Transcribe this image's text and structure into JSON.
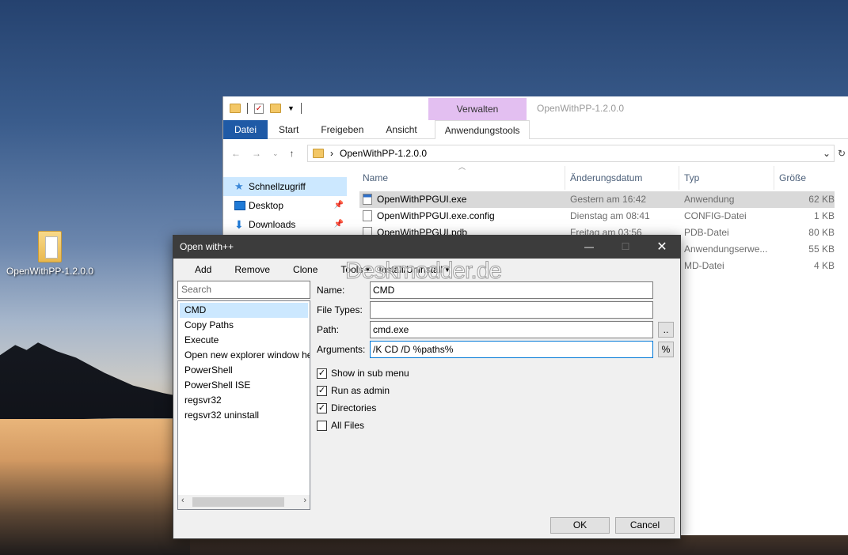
{
  "desktop": {
    "icon_label": "OpenWithPP-1.2.0.0"
  },
  "explorer": {
    "title": "OpenWithPP-1.2.0.0",
    "context_tab": "Verwalten",
    "ribbon_tabs": [
      "Datei",
      "Start",
      "Freigeben",
      "Ansicht",
      "Anwendungstools"
    ],
    "path": "OpenWithPP-1.2.0.0",
    "nav": {
      "quick_access": "Schnellzugriff",
      "desktop": "Desktop",
      "downloads": "Downloads"
    },
    "columns": {
      "name": "Name",
      "date": "Änderungsdatum",
      "type": "Typ",
      "size": "Größe"
    },
    "files": [
      {
        "name": "OpenWithPPGUI.exe",
        "date": "Gestern am 16:42",
        "type": "Anwendung",
        "size": "62 KB"
      },
      {
        "name": "OpenWithPPGUI.exe.config",
        "date": "Dienstag am 08:41",
        "type": "CONFIG-Datei",
        "size": "1 KB"
      },
      {
        "name": "OpenWithPPGUI.pdb",
        "date": "Freitag am 03:56",
        "type": "PDB-Datei",
        "size": "80 KB"
      },
      {
        "name": "",
        "date": "",
        "type": "Anwendungserwe...",
        "size": "55 KB"
      },
      {
        "name": "",
        "date": "",
        "type": "MD-Datei",
        "size": "4 KB"
      }
    ]
  },
  "dialog": {
    "title": "Open with++",
    "toolbar": {
      "add": "Add",
      "remove": "Remove",
      "clone": "Clone",
      "tools": "Tools",
      "install": "Install/Uninstall"
    },
    "search_placeholder": "Search",
    "items": [
      "CMD",
      "Copy Paths",
      "Execute",
      "Open new explorer window he",
      "PowerShell",
      "PowerShell ISE",
      "regsvr32",
      "regsvr32 uninstall"
    ],
    "labels": {
      "name": "Name:",
      "file_types": "File Types:",
      "path": "Path:",
      "arguments": "Arguments:"
    },
    "values": {
      "name": "CMD",
      "file_types": "",
      "path": "cmd.exe",
      "arguments": "/K CD /D %paths%"
    },
    "browse_label": "..",
    "percent_label": "%",
    "checkboxes": {
      "show_in_sub_menu": {
        "label": "Show in sub menu",
        "checked": true
      },
      "run_as_admin": {
        "label": "Run as admin",
        "checked": true
      },
      "directories": {
        "label": "Directories",
        "checked": true
      },
      "all_files": {
        "label": "All Files",
        "checked": false
      }
    },
    "ok": "OK",
    "cancel": "Cancel"
  },
  "watermark": "Deskmodder.de"
}
